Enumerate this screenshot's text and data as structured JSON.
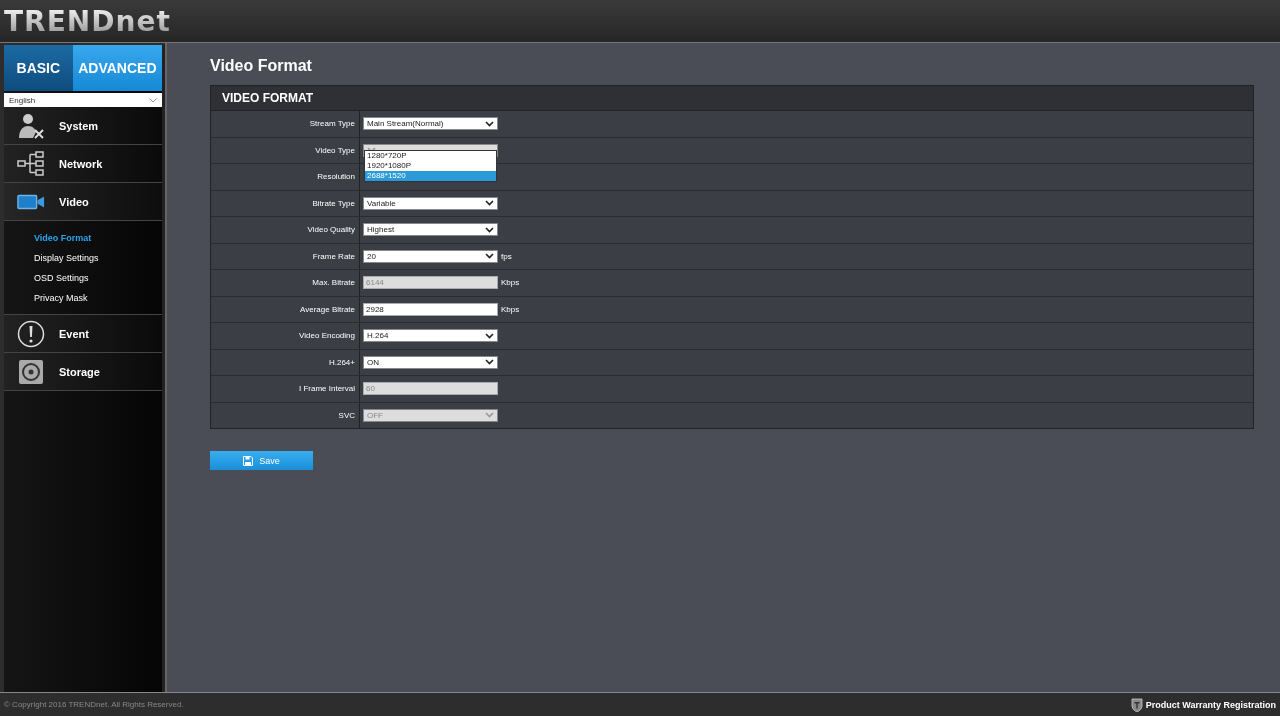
{
  "header": {
    "logo": "TRENDnet"
  },
  "sidebar": {
    "tabs": [
      {
        "label": "BASIC",
        "selected": false
      },
      {
        "label": "ADVANCED",
        "selected": true
      }
    ],
    "language": "English",
    "items": [
      {
        "label": "System"
      },
      {
        "label": "Network"
      },
      {
        "label": "Video",
        "expanded": true,
        "children": [
          {
            "label": "Video Format",
            "selected": true
          },
          {
            "label": "Display Settings",
            "selected": false
          },
          {
            "label": "OSD Settings",
            "selected": false
          },
          {
            "label": "Privacy Mask",
            "selected": false
          }
        ]
      },
      {
        "label": "Event"
      },
      {
        "label": "Storage"
      }
    ]
  },
  "page_title": "Video Format",
  "panel": {
    "title": "VIDEO FORMAT",
    "rows": [
      {
        "label": "Stream Type",
        "kind": "select",
        "value": "Main Stream(Normal)",
        "disabled": false
      },
      {
        "label": "Video Type",
        "kind": "select",
        "disabled": true,
        "open": true,
        "options": [
          {
            "label": "1280*720P",
            "selected": false
          },
          {
            "label": "1920*1080P",
            "selected": false
          },
          {
            "label": "2688*1520",
            "selected": true
          }
        ]
      },
      {
        "label": "Resolution",
        "kind": "covered"
      },
      {
        "label": "Bitrate Type",
        "kind": "select",
        "value": "Variable",
        "disabled": false
      },
      {
        "label": "Video Quality",
        "kind": "select",
        "value": "Highest",
        "disabled": false
      },
      {
        "label": "Frame Rate",
        "kind": "select",
        "value": "20",
        "disabled": false,
        "unit": "fps"
      },
      {
        "label": "Max. Bitrate",
        "kind": "input",
        "value": "6144",
        "disabled": true,
        "unit": "Kbps"
      },
      {
        "label": "Average Bitrate",
        "kind": "input",
        "value": "2928",
        "disabled": false,
        "unit": "Kbps"
      },
      {
        "label": "Video Encoding",
        "kind": "select",
        "value": "H.264",
        "disabled": false
      },
      {
        "label": "H.264+",
        "kind": "select",
        "value": "ON",
        "disabled": false
      },
      {
        "label": "I Frame Interval",
        "kind": "input",
        "value": "60",
        "disabled": true
      },
      {
        "label": "SVC",
        "kind": "select",
        "value": "OFF",
        "disabled": true
      }
    ]
  },
  "save_button": "Save",
  "footer": {
    "copyright": "© Copyright 2016 TRENDnet. All Rights Reserved.",
    "warranty": "Product Warranty Registration"
  }
}
